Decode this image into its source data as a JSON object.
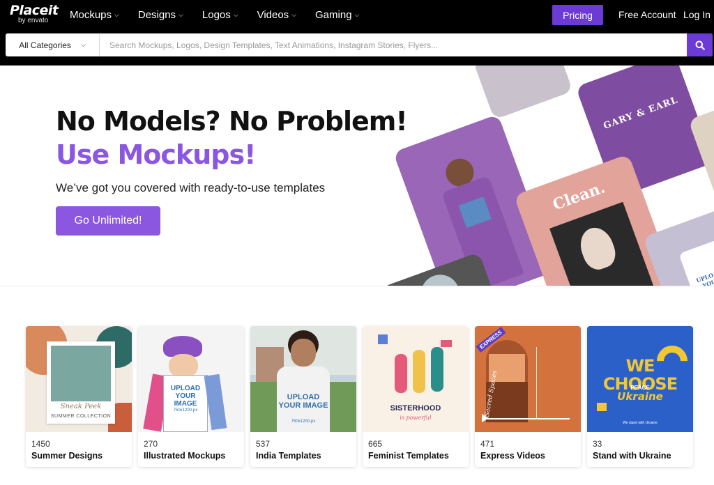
{
  "header": {
    "logo": "Placeit",
    "logo_sub": "by envato",
    "nav": [
      {
        "label": "Mockups"
      },
      {
        "label": "Designs"
      },
      {
        "label": "Logos"
      },
      {
        "label": "Videos"
      },
      {
        "label": "Gaming"
      }
    ],
    "pricing": "Pricing",
    "free_account": "Free Account",
    "login": "Log In"
  },
  "search": {
    "category": "All Categories",
    "placeholder": "Search Mockups, Logos, Design Templates, Text Animations, Instagram Stories, Flyers..."
  },
  "hero": {
    "title": "No Models? No Problem!",
    "subtitle": "Use Mockups!",
    "text": "We’ve got you covered with ready-to-use templates",
    "cta": "Go Unlimited!",
    "collage_labels": {
      "gary": "GARY & EARL",
      "clean": "Clean.",
      "upload": "UPLOAD YOUR IMAGE"
    }
  },
  "cards": [
    {
      "count": "1450",
      "title": "Summer Designs",
      "img_text": "Sneak Peek",
      "img_text2": "SUMMER COLLECTION"
    },
    {
      "count": "270",
      "title": "Illustrated Mockups",
      "img_text": "UPLOAD YOUR IMAGE",
      "img_text2": "750x1200-px"
    },
    {
      "count": "537",
      "title": "India Templates",
      "img_text": "UPLOAD YOUR IMAGE",
      "img_text2": "750x1200-px"
    },
    {
      "count": "665",
      "title": "Feminist Templates",
      "img_text": "SISTERHOOD",
      "img_text2": "is powerful"
    },
    {
      "count": "471",
      "title": "Express Videos",
      "img_text": "EXPRESS",
      "img_text2": "Sacred Spaces"
    },
    {
      "count": "33",
      "title": "Stand with Ukraine",
      "img_text": "WE CHOOSE",
      "img_text2": "PEACE",
      "img_text3": "Ukraine",
      "img_text4": "We stand with Ukraine"
    }
  ],
  "colors": {
    "accent": "#6c3ad4",
    "accent_light": "#8b56e0"
  }
}
